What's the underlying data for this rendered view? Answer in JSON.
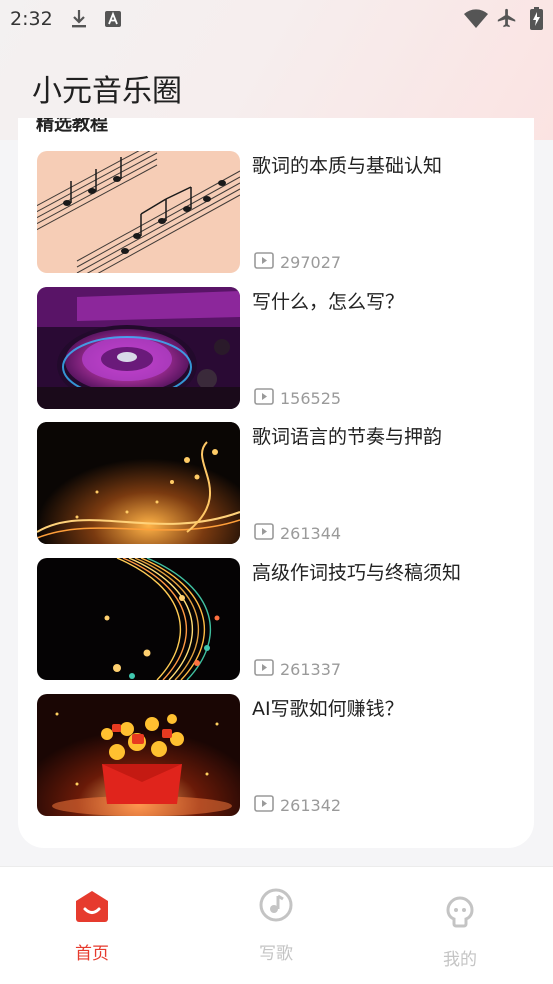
{
  "status_bar": {
    "time": "2:32",
    "icons": [
      "download-icon",
      "font-a-icon",
      "wifi-icon",
      "airplane-mode-icon",
      "battery-charging-icon"
    ]
  },
  "header": {
    "title": "小元音乐圈"
  },
  "section": {
    "title": "精选教程"
  },
  "tutorials": [
    {
      "title": "歌词的本质与基础认知",
      "views": "297027",
      "thumb": "sheet-music-image"
    },
    {
      "title": "写什么，怎么写？",
      "views": "156525",
      "thumb": "dj-turntable-image"
    },
    {
      "title": "歌词语言的节奏与押韵",
      "views": "261344",
      "thumb": "golden-music-wave-image"
    },
    {
      "title": "高级作词技巧与终稿须知",
      "views": "261337",
      "thumb": "swirling-music-notes-image"
    },
    {
      "title": "AI写歌如何赚钱？",
      "views": "261342",
      "thumb": "red-envelope-coins-image"
    }
  ],
  "bottom_nav": {
    "tabs": [
      {
        "label": "首页",
        "icon": "home-icon",
        "active": true
      },
      {
        "label": "写歌",
        "icon": "music-note-icon",
        "active": false
      },
      {
        "label": "我的",
        "icon": "profile-icon",
        "active": false
      }
    ]
  },
  "colors": {
    "accent": "#e63b2e",
    "inactive": "#c4c4c4",
    "muted_text": "#9a9a9a"
  }
}
